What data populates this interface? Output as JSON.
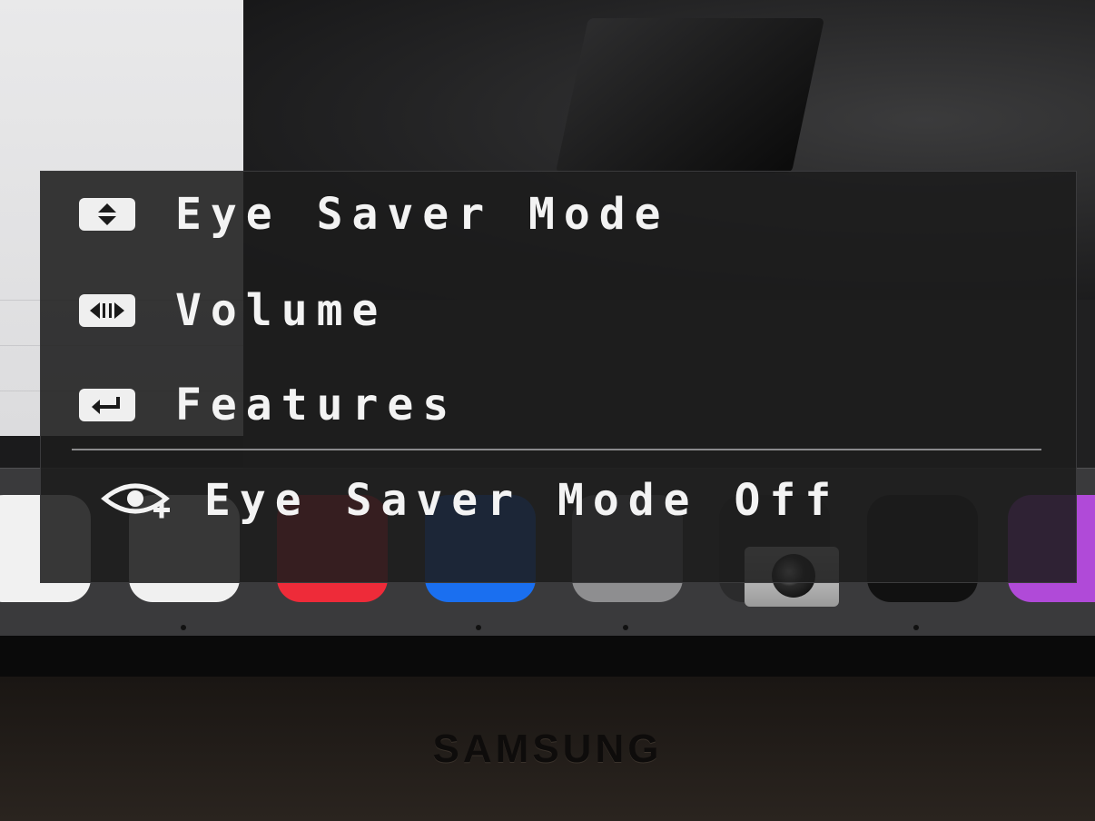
{
  "osd_menu": {
    "items": [
      {
        "label": "Eye Saver Mode",
        "icon": "up-down-arrows-icon"
      },
      {
        "label": "Volume",
        "icon": "left-right-arrows-icon"
      },
      {
        "label": "Features",
        "icon": "enter-return-icon"
      }
    ],
    "status": {
      "label": "Eye Saver Mode Off",
      "icon": "eye-saver-icon"
    }
  },
  "monitor": {
    "brand": "SAMSUNG"
  },
  "colors": {
    "osd_background": "#1c1c1d",
    "osd_text": "#f3f3f3",
    "keycap": "#efefef",
    "dock": "#3a3a3c"
  }
}
